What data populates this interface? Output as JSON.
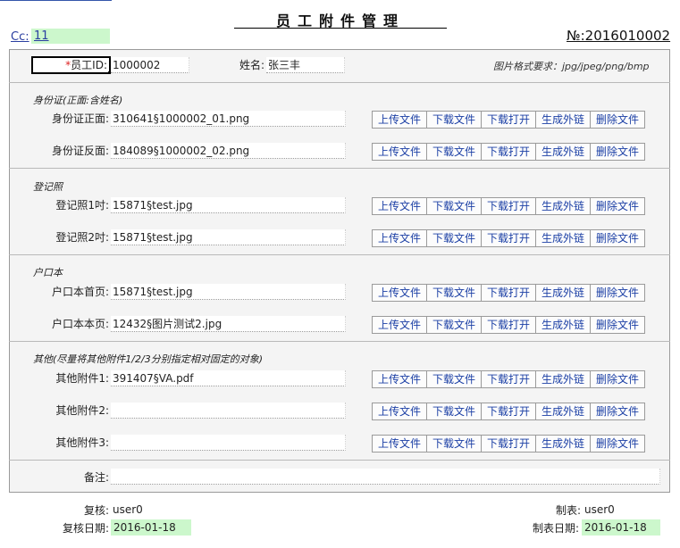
{
  "header": {
    "title": "员工附件管理",
    "cc_label": "Cc:",
    "cc_value": "11",
    "doc_no": "№:2016010002"
  },
  "employee": {
    "id_label": "员工ID:",
    "id_required_mark": "*",
    "id_value": "1000002",
    "name_label": "姓名:",
    "name_value": "张三丰",
    "format_hint": "图片格式要求：jpg/jpeg/png/bmp"
  },
  "buttons": {
    "upload": "上传文件",
    "download": "下载文件",
    "download_open": "下载打开",
    "gen_link": "生成外链",
    "delete": "删除文件"
  },
  "sections": [
    {
      "title": "身份证(正面:含姓名)",
      "rows": [
        {
          "label": "身份证正面:",
          "value": "310641§1000002_01.png"
        },
        {
          "label": "身份证反面:",
          "value": "184089§1000002_02.png"
        }
      ]
    },
    {
      "title": "登记照",
      "rows": [
        {
          "label": "登记照1吋:",
          "value": "15871§test.jpg"
        },
        {
          "label": "登记照2吋:",
          "value": "15871§test.jpg"
        }
      ]
    },
    {
      "title": "户口本",
      "rows": [
        {
          "label": "户口本首页:",
          "value": "15871§test.jpg"
        },
        {
          "label": "户口本本页:",
          "value": "12432§图片测试2.jpg"
        }
      ]
    },
    {
      "title": "其他(尽量将其他附件1/2/3分别指定相对固定的对象)",
      "rows": [
        {
          "label": "其他附件1:",
          "value": "391407§VA.pdf"
        },
        {
          "label": "其他附件2:",
          "value": ""
        },
        {
          "label": "其他附件3:",
          "value": ""
        }
      ]
    }
  ],
  "remarks": {
    "label": "备注:",
    "value": ""
  },
  "footer": {
    "reviewer_label": "复核:",
    "reviewer_value": "user0",
    "review_date_label": "复核日期:",
    "review_date_value": "2016-01-18",
    "maker_label": "制表:",
    "maker_value": "user0",
    "make_date_label": "制表日期:",
    "make_date_value": "2016-01-18"
  }
}
